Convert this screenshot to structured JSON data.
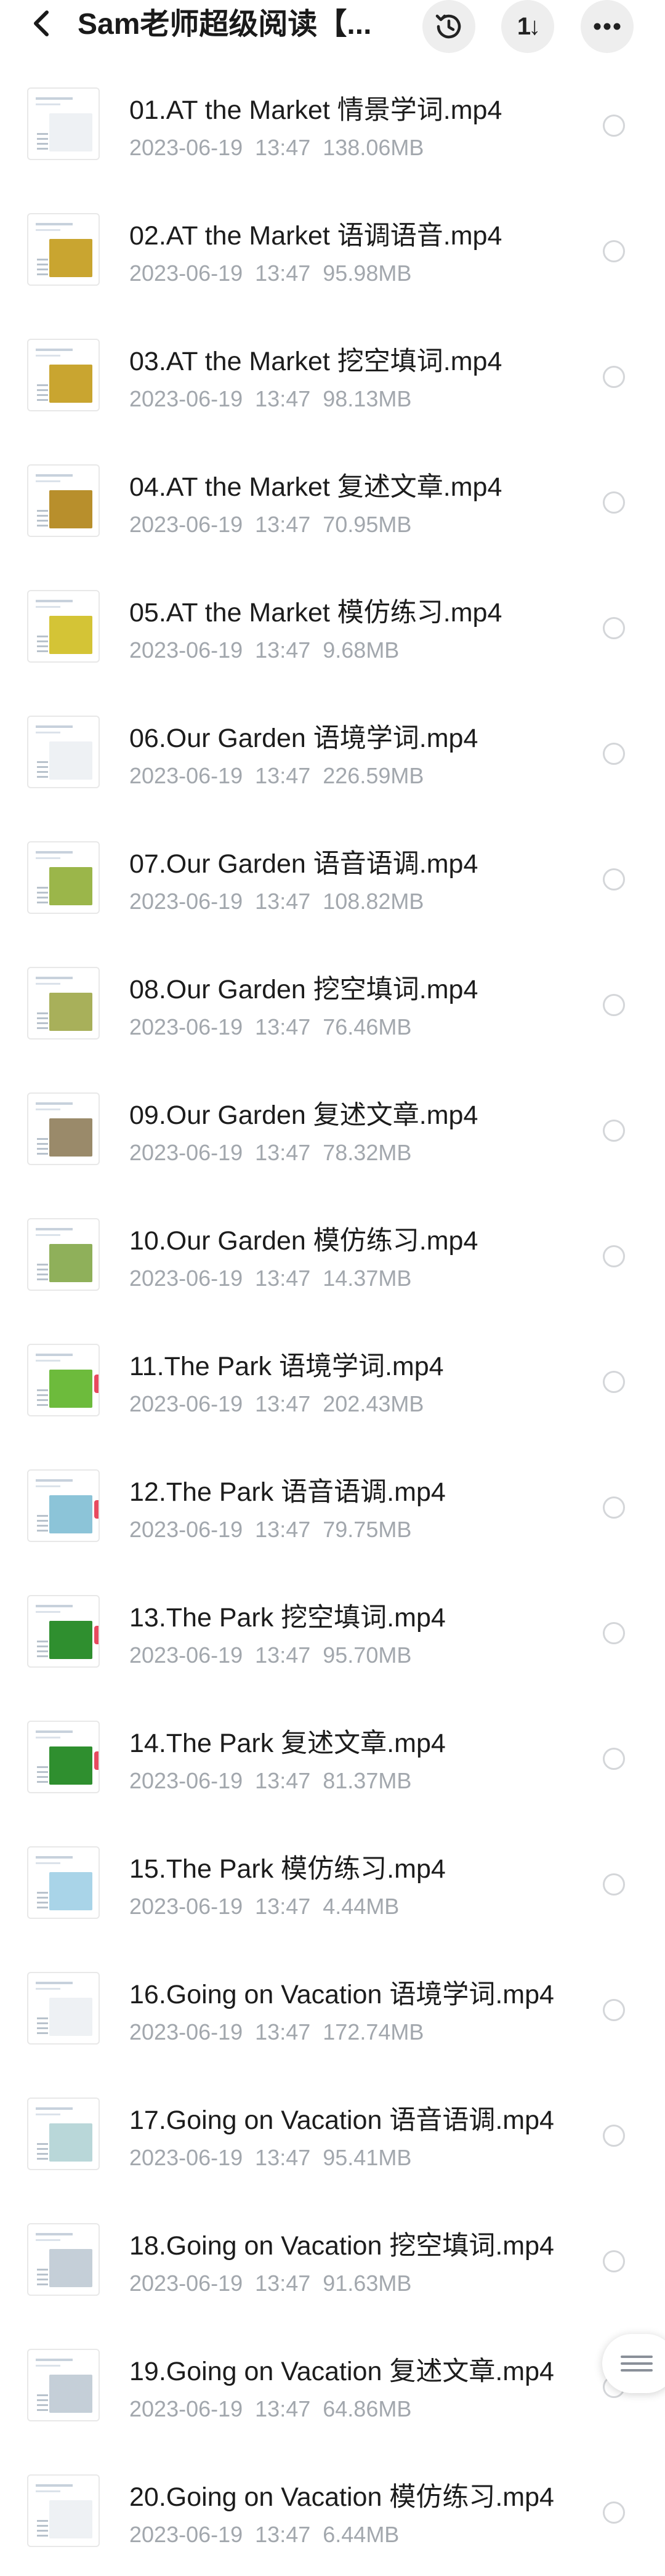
{
  "header": {
    "title": "Sam老师超级阅读【...",
    "back_icon": "back-arrow-icon",
    "history_icon": "history-icon",
    "sort_icon": "sort-icon",
    "sort_label": "1↓",
    "more_icon": "more-icon"
  },
  "files": [
    {
      "name": "01.AT the Market 情景学词.mp4",
      "date": "2023-06-19",
      "time": "13:47",
      "size": "138.06MB",
      "thumb_color": "#ffffff"
    },
    {
      "name": "02.AT the Market 语调语音.mp4",
      "date": "2023-06-19",
      "time": "13:47",
      "size": "95.98MB",
      "thumb_color": "#c9a530"
    },
    {
      "name": "03.AT the Market 挖空填词.mp4",
      "date": "2023-06-19",
      "time": "13:47",
      "size": "98.13MB",
      "thumb_color": "#c9a530"
    },
    {
      "name": "04.AT the Market 复述文章.mp4",
      "date": "2023-06-19",
      "time": "13:47",
      "size": "70.95MB",
      "thumb_color": "#b88f2c"
    },
    {
      "name": "05.AT the Market 模仿练习.mp4",
      "date": "2023-06-19",
      "time": "13:47",
      "size": "9.68MB",
      "thumb_color": "#d4c436"
    },
    {
      "name": "06.Our Garden 语境学词.mp4",
      "date": "2023-06-19",
      "time": "13:47",
      "size": "226.59MB",
      "thumb_color": "#ffffff"
    },
    {
      "name": "07.Our Garden 语音语调.mp4",
      "date": "2023-06-19",
      "time": "13:47",
      "size": "108.82MB",
      "thumb_color": "#9bb64a"
    },
    {
      "name": "08.Our Garden 挖空填词.mp4",
      "date": "2023-06-19",
      "time": "13:47",
      "size": "76.46MB",
      "thumb_color": "#a8b05a"
    },
    {
      "name": "09.Our Garden 复述文章.mp4",
      "date": "2023-06-19",
      "time": "13:47",
      "size": "78.32MB",
      "thumb_color": "#9a8a6a"
    },
    {
      "name": "10.Our Garden 模仿练习.mp4",
      "date": "2023-06-19",
      "time": "13:47",
      "size": "14.37MB",
      "thumb_color": "#8fb05a"
    },
    {
      "name": "11.The Park 语境学词.mp4",
      "date": "2023-06-19",
      "time": "13:47",
      "size": "202.43MB",
      "thumb_color": "#6dbb3c"
    },
    {
      "name": "12.The Park 语音语调.mp4",
      "date": "2023-06-19",
      "time": "13:47",
      "size": "79.75MB",
      "thumb_color": "#8cc4d8"
    },
    {
      "name": "13.The Park 挖空填词.mp4",
      "date": "2023-06-19",
      "time": "13:47",
      "size": "95.70MB",
      "thumb_color": "#2f8f2f"
    },
    {
      "name": "14.The Park 复述文章.mp4",
      "date": "2023-06-19",
      "time": "13:47",
      "size": "81.37MB",
      "thumb_color": "#2f8f2f"
    },
    {
      "name": "15.The Park 模仿练习.mp4",
      "date": "2023-06-19",
      "time": "13:47",
      "size": "4.44MB",
      "thumb_color": "#a9d4e8"
    },
    {
      "name": "16.Going on Vacation 语境学词.mp4",
      "date": "2023-06-19",
      "time": "13:47",
      "size": "172.74MB",
      "thumb_color": "#ffffff"
    },
    {
      "name": "17.Going on Vacation 语音语调.mp4",
      "date": "2023-06-19",
      "time": "13:47",
      "size": "95.41MB",
      "thumb_color": "#b9d7d9"
    },
    {
      "name": "18.Going on Vacation 挖空填词.mp4",
      "date": "2023-06-19",
      "time": "13:47",
      "size": "91.63MB",
      "thumb_color": "#c5cfd8"
    },
    {
      "name": "19.Going on Vacation 复述文章.mp4",
      "date": "2023-06-19",
      "time": "13:47",
      "size": "64.86MB",
      "thumb_color": "#c5cfd8"
    },
    {
      "name": "20.Going on Vacation 模仿练习.mp4",
      "date": "2023-06-19",
      "time": "13:47",
      "size": "6.44MB",
      "thumb_color": "#ffffff"
    }
  ],
  "floating_menu_icon": "menu-lines-icon"
}
